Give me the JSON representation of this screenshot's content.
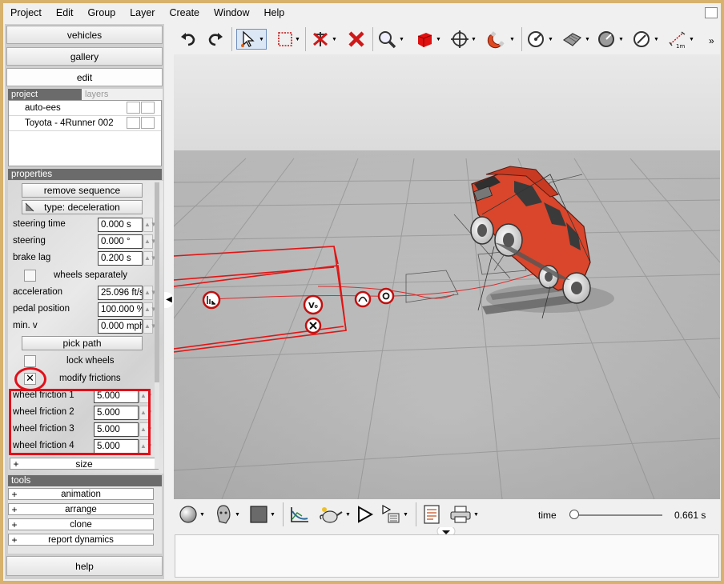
{
  "menu": [
    "Project",
    "Edit",
    "Group",
    "Layer",
    "Create",
    "Window",
    "Help"
  ],
  "left": {
    "nav": {
      "vehicles": "vehicles",
      "gallery": "gallery",
      "edit": "edit"
    },
    "tabs": {
      "project": "project",
      "layers": "layers"
    },
    "project_items": [
      "auto-ees",
      "Toyota - 4Runner 002"
    ],
    "properties_header": "properties",
    "remove_sequence": "remove sequence",
    "type_button": "type: deceleration",
    "steering_time_label": "steering time",
    "steering_time_value": "0.000 s",
    "steering_label": "steering",
    "steering_value": "0.000 °",
    "brake_lag_label": "brake lag",
    "brake_lag_value": "0.200 s",
    "wheels_separately": "wheels separately",
    "acceleration_label": "acceleration",
    "acceleration_value": "25.096 ft/s",
    "pedal_label": "pedal position",
    "pedal_value": "100.000 %",
    "minv_label": "min. v",
    "minv_value": "0.000 mph",
    "pick_path": "pick path",
    "lock_wheels": "lock wheels",
    "modify_frictions": "modify frictions",
    "modify_frictions_check": "✕",
    "frictions": [
      {
        "label": "wheel friction 1",
        "value": "5.000"
      },
      {
        "label": "wheel friction 2",
        "value": "5.000"
      },
      {
        "label": "wheel friction 3",
        "value": "5.000"
      },
      {
        "label": "wheel friction 4",
        "value": "5.000"
      }
    ],
    "size": "size",
    "plus": "+",
    "tools_header": "tools",
    "tools": [
      "animation",
      "arrange",
      "clone",
      "report dynamics"
    ],
    "help": "help"
  },
  "viewport": {
    "markers": [
      "V₀"
    ]
  },
  "bottom": {
    "time_label": "time",
    "time_value": "0.661 s",
    "time_fraction": 0.05
  },
  "toolbar_overflow": "»",
  "icons": [
    "undo-icon",
    "redo-icon",
    "select-arrow-icon",
    "marquee-icon",
    "delete-pin-icon",
    "delete-x-icon",
    "zoom-icon",
    "cube-icon",
    "move-icon",
    "magnet-icon",
    "gauge-icon",
    "surface-icon",
    "dial-icon",
    "compass-icon",
    "measure-icon",
    "sphere-icon",
    "head-icon",
    "color-swatch-icon",
    "graph-icon",
    "teapot-icon",
    "play-icon",
    "render-icon",
    "notes-icon",
    "printer-icon"
  ],
  "colors": {
    "accent_red": "#e0101a",
    "frame": "#d6b26d",
    "vehicle": "#d9462c"
  }
}
